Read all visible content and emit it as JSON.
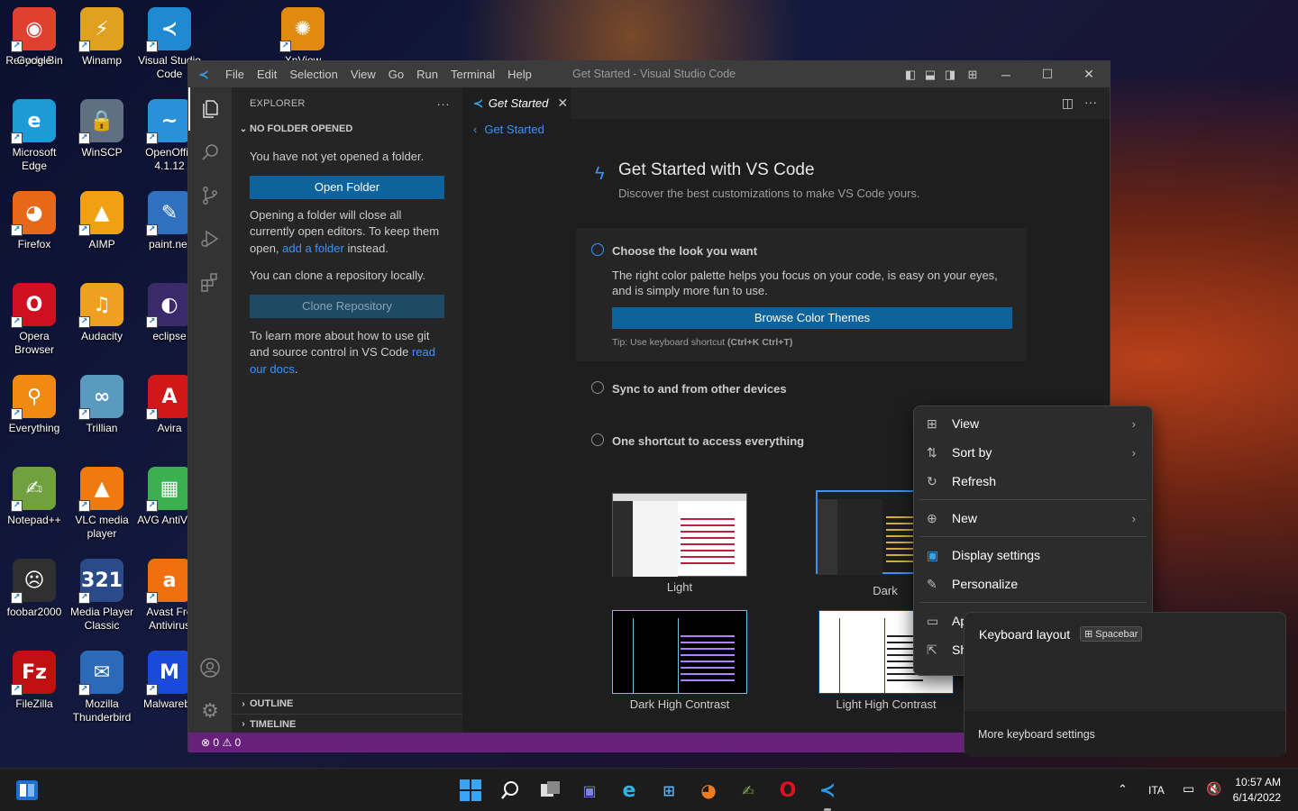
{
  "desktop": {
    "icons": [
      {
        "label": "Recycle Bin",
        "glyph": "♻",
        "color": "#8aa8c8"
      },
      {
        "label": "Winamp",
        "glyph": "⚡",
        "color": "#e0a020"
      },
      {
        "label": "Visual Studio Code",
        "glyph": "≺",
        "color": "#1f8ad2"
      },
      {
        "label": "Google",
        "glyph": "◉",
        "color": "#e04030"
      },
      {
        "label": "XnView",
        "glyph": "✺",
        "color": "#e08a10"
      },
      {
        "label": "Microsoft Edge",
        "glyph": "e",
        "color": "#1e9ad6"
      },
      {
        "label": "WinSCP",
        "glyph": "🔒",
        "color": "#607080"
      },
      {
        "label": "OpenOffic 4.1.12",
        "glyph": "~",
        "color": "#2a90d8"
      },
      {
        "label": "Firefox",
        "glyph": "◕",
        "color": "#e8681a"
      },
      {
        "label": "AIMP",
        "glyph": "▲",
        "color": "#f0a010"
      },
      {
        "label": "paint.net",
        "glyph": "✎",
        "color": "#3070c0"
      },
      {
        "label": "Opera Browser",
        "glyph": "O",
        "color": "#d01020"
      },
      {
        "label": "Audacity",
        "glyph": "♫",
        "color": "#f0a020"
      },
      {
        "label": "eclipse",
        "glyph": "◐",
        "color": "#3a2a6a"
      },
      {
        "label": "Everything",
        "glyph": "⚲",
        "color": "#f08a10"
      },
      {
        "label": "Trillian",
        "glyph": "∞",
        "color": "#5a9ac0"
      },
      {
        "label": "Avira",
        "glyph": "A",
        "color": "#d01818"
      },
      {
        "label": "Notepad++",
        "glyph": "✍",
        "color": "#70a040"
      },
      {
        "label": "VLC media player",
        "glyph": "▲",
        "color": "#f07a10"
      },
      {
        "label": "AVG AntiVir...",
        "glyph": "▦",
        "color": "#3ab050"
      },
      {
        "label": "foobar2000",
        "glyph": "☹",
        "color": "#303030"
      },
      {
        "label": "Media Player Classic",
        "glyph": "321",
        "color": "#2a4a8a"
      },
      {
        "label": "Avast Fre Antivirus",
        "glyph": "a",
        "color": "#f07010"
      },
      {
        "label": "FileZilla",
        "glyph": "Fz",
        "color": "#c01010"
      },
      {
        "label": "Mozilla Thunderbird",
        "glyph": "✉",
        "color": "#2a6ab8"
      },
      {
        "label": "Malwareby",
        "glyph": "M",
        "color": "#1a4ad8"
      }
    ]
  },
  "vscode": {
    "title": "Get Started - Visual Studio Code",
    "menu": [
      "File",
      "Edit",
      "Selection",
      "View",
      "Go",
      "Run",
      "Terminal",
      "Help"
    ],
    "explorer": {
      "header": "EXPLORER",
      "section": "NO FOLDER OPENED",
      "msg1": "You have not yet opened a folder.",
      "open_btn": "Open Folder",
      "msg2a": "Opening a folder will close all currently open editors. To keep them open, ",
      "msg2link": "add a folder",
      "msg2b": " instead.",
      "msg3": "You can clone a repository locally.",
      "clone_btn": "Clone Repository",
      "msg4a": "To learn more about how to use git and source control in VS Code ",
      "msg4link": "read our docs",
      "msg4b": ".",
      "outline": "OUTLINE",
      "timeline": "TIMELINE"
    },
    "tab": "Get Started",
    "breadcrumb": "Get Started",
    "gs": {
      "title": "Get Started with VS Code",
      "subtitle": "Discover the best customizations to make VS Code yours.",
      "step1": "Choose the look you want",
      "step1desc": "The right color palette helps you focus on your code, is easy on your eyes, and is simply more fun to use.",
      "step1btn": "Browse Color Themes",
      "tip_prefix": "Tip: Use keyboard shortcut ",
      "tip_keys": "(Ctrl+K Ctrl+T)",
      "step2": "Sync to and from other devices",
      "step3": "One shortcut to access everything",
      "themes": [
        "Light",
        "Dark",
        "Dark High Contrast",
        "Light High Contrast"
      ]
    },
    "status": {
      "errors": "0",
      "warnings": "0"
    }
  },
  "context_menu": {
    "items": [
      "View",
      "Sort by",
      "Refresh",
      "New",
      "Display settings",
      "Personalize",
      "Ap",
      "Sh"
    ]
  },
  "keyboard_flyout": {
    "title": "Keyboard layout",
    "badge": "Spacebar",
    "more": "More keyboard settings"
  },
  "taskbar": {
    "lang": "ITA",
    "time": "10:57 AM",
    "date": "6/14/2022"
  },
  "colors": {
    "accent": "#0e639c",
    "statusbar": "#68217a",
    "link": "#3794ff"
  }
}
